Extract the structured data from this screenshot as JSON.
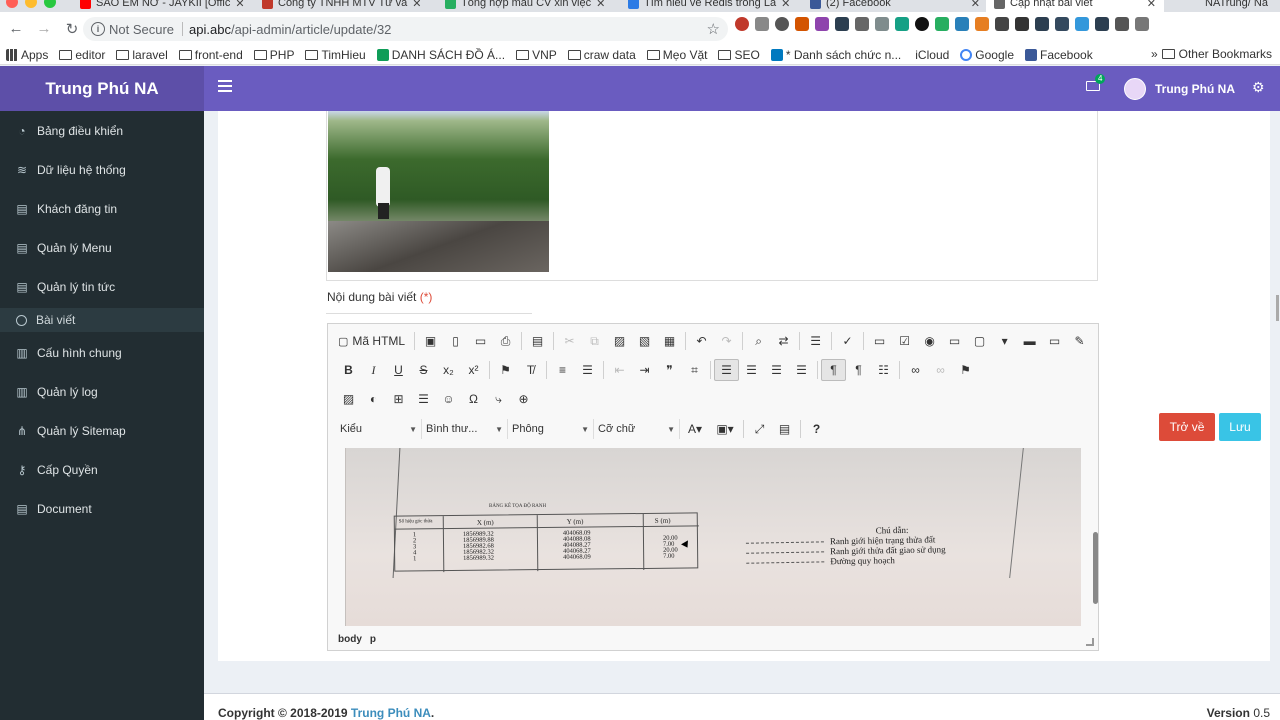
{
  "browser": {
    "tabs": [
      {
        "title": "SAO EM NỠ - JAYKII [Offic",
        "color": "#ff0000"
      },
      {
        "title": "Công ty TNHH MTV Tư vấ",
        "color": "#c0392b"
      },
      {
        "title": "Tổng hợp mẫu CV xin việc",
        "color": "#27ae60"
      },
      {
        "title": "Tìm hiểu về Redis trong La",
        "color": "#2c7be5"
      },
      {
        "title": "(2) Facebook",
        "color": "#3b5998"
      },
      {
        "title": "Cập nhật bài viết",
        "color": "#666666"
      }
    ],
    "profile_label": "NATrung/ Na",
    "url_security": "Not Secure",
    "url_host": "api.abc",
    "url_path": "/api-admin/article/update/32",
    "bookmarks": [
      "Apps",
      "editor",
      "laravel",
      "front-end",
      "PHP",
      "TimHieu",
      "DANH SÁCH ĐỒ Á...",
      "VNP",
      "craw data",
      "Mẹo Vặt",
      "SEO",
      "* Danh sách chức n...",
      "iCloud",
      "Google",
      "Facebook"
    ],
    "bookmarks_more": "»",
    "other_bookmarks": "Other Bookmarks"
  },
  "app": {
    "brand": "Trung Phú NA",
    "mail_count": "4",
    "user_name": "Trung Phú NA"
  },
  "sidebar": {
    "items": [
      {
        "label": "Bảng điều khiển",
        "icon": "dashboard-icon"
      },
      {
        "label": "Dữ liệu hệ thống",
        "icon": "database-icon"
      },
      {
        "label": "Khách đăng tin",
        "icon": "file-icon"
      },
      {
        "label": "Quản lý Menu",
        "icon": "file-icon"
      },
      {
        "label": "Quản lý tin tức",
        "icon": "file-icon"
      },
      {
        "label": "Bài viết",
        "icon": "circle-icon"
      },
      {
        "label": "Cấu hình chung",
        "icon": "book-icon"
      },
      {
        "label": "Quản lý log",
        "icon": "book-icon"
      },
      {
        "label": "Quản lý Sitemap",
        "icon": "sitemap-icon"
      },
      {
        "label": "Cấp Quyền",
        "icon": "key-icon"
      },
      {
        "label": "Document",
        "icon": "file-icon"
      }
    ]
  },
  "form": {
    "content_label": "Nội dung bài viết",
    "required_mark": "(*)"
  },
  "editor": {
    "source_label": "Mã HTML",
    "styles_label": "Kiểu",
    "format_label": "Bình thư...",
    "font_label": "Phông",
    "size_label": "Cỡ chữ",
    "status_path": [
      "body",
      "p"
    ]
  },
  "scan": {
    "table_title": "BẢNG KÊ TỌA ĐỘ RANH",
    "headers": [
      "Số hiệu góc thửa",
      "X (m)",
      "Y (m)",
      "S (m)"
    ],
    "col_no": "1\n2\n3\n4\n1",
    "col_x": "1856989.32\n1856989.88\n1856982.68\n1856982.32\n1856989.32",
    "col_y": "404068.09\n404088.08\n404088.27\n404068.27\n404068.09",
    "col_s": "20.00\n7.00\n20.00\n7.00",
    "legend_title": "Chú dẫn:",
    "legend": [
      "Ranh giới hiện trạng thửa đất",
      "Ranh giới thửa đất giao sử dụng",
      "Đường quy hoạch"
    ]
  },
  "actions": {
    "back": "Trở về",
    "save": "Lưu"
  },
  "footer": {
    "copyright": "Copyright © 2018-2019",
    "brand": "Trung Phú NA",
    "dot": ".",
    "version_label": "Version",
    "version": "0.5"
  }
}
